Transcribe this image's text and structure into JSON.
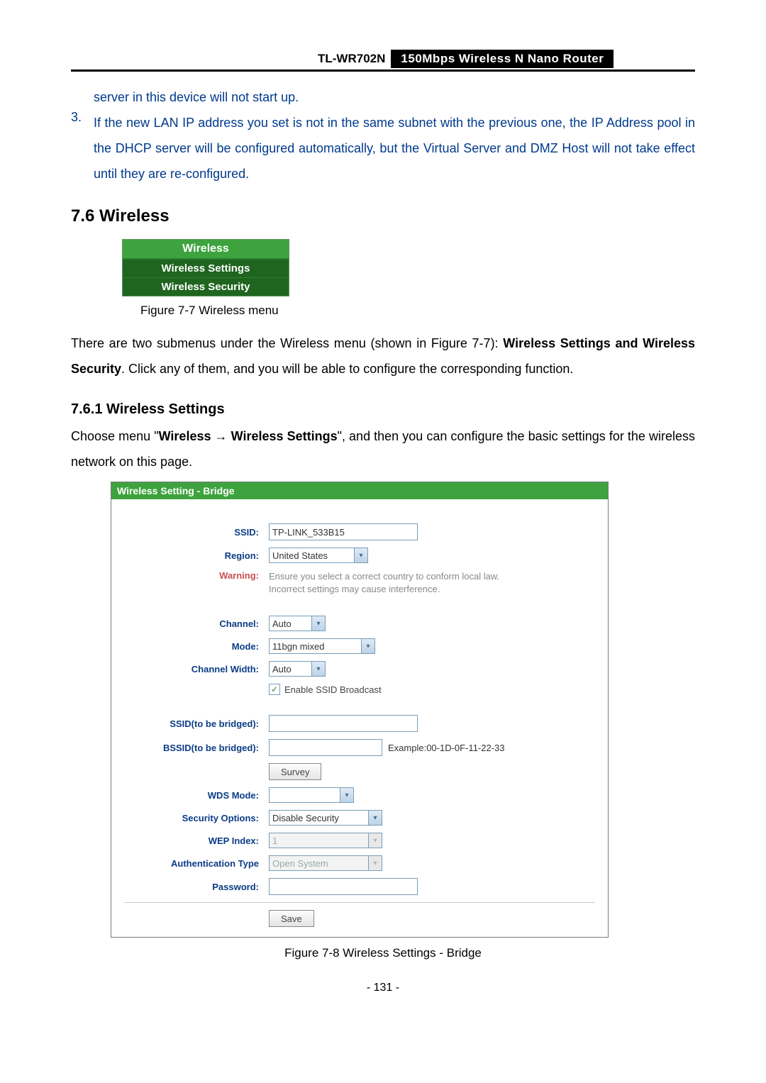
{
  "header": {
    "model": "TL-WR702N",
    "description": "150Mbps Wireless N Nano Router"
  },
  "continued_text": "server in this device will not start up.",
  "list_item_3": "If the new LAN IP address you set is not in the same subnet with the previous one, the IP Address pool in the DHCP server will be configured automatically, but the Virtual Server and DMZ Host will not take effect until they are re-configured.",
  "section_title": "7.6  Wireless",
  "menu": {
    "header": "Wireless",
    "items": [
      "Wireless Settings",
      "Wireless Security"
    ]
  },
  "figure77_caption": "Figure 7-7    Wireless menu",
  "para1_pre": "There are two submenus under the Wireless menu (shown in Figure 7-7): ",
  "para1_bold": "Wireless Settings and Wireless Security",
  "para1_post": ". Click any of them, and you will be able to configure the corresponding function.",
  "subsection_title": "7.6.1    Wireless Settings",
  "para2_pre": "Choose menu \"",
  "para2_b1": "Wireless",
  "para2_arrow": " → ",
  "para2_b2": "Wireless Settings",
  "para2_post": "\", and then you can configure the basic settings for the wireless network on this page.",
  "panel": {
    "title": "Wireless Setting - Bridge",
    "labels": {
      "ssid": "SSID:",
      "region": "Region:",
      "warning": "Warning:",
      "channel": "Channel:",
      "mode": "Mode:",
      "channel_width": "Channel Width:",
      "ssid_bridged": "SSID(to be bridged):",
      "bssid_bridged": "BSSID(to be bridged):",
      "wds_mode": "WDS Mode:",
      "security_options": "Security Options:",
      "wep_index": "WEP Index:",
      "auth_type": "Authentication Type",
      "password": "Password:"
    },
    "values": {
      "ssid": "TP-LINK_533B15",
      "region": "United States",
      "warning": "Ensure you select a correct country to conform local law. Incorrect settings may cause interference.",
      "channel": "Auto",
      "mode": "11bgn mixed",
      "channel_width": "Auto",
      "enable_ssid_broadcast": "Enable SSID Broadcast",
      "ssid_bridged": "",
      "bssid_bridged": "",
      "bssid_example": "Example:00-1D-0F-11-22-33",
      "survey": "Survey",
      "wds_mode": "",
      "security_options": "Disable Security",
      "wep_index": "1",
      "auth_type": "Open System",
      "password": "",
      "save": "Save"
    }
  },
  "figure78_caption": "Figure 7-8 Wireless Settings - Bridge",
  "page_number": "- 131 -"
}
